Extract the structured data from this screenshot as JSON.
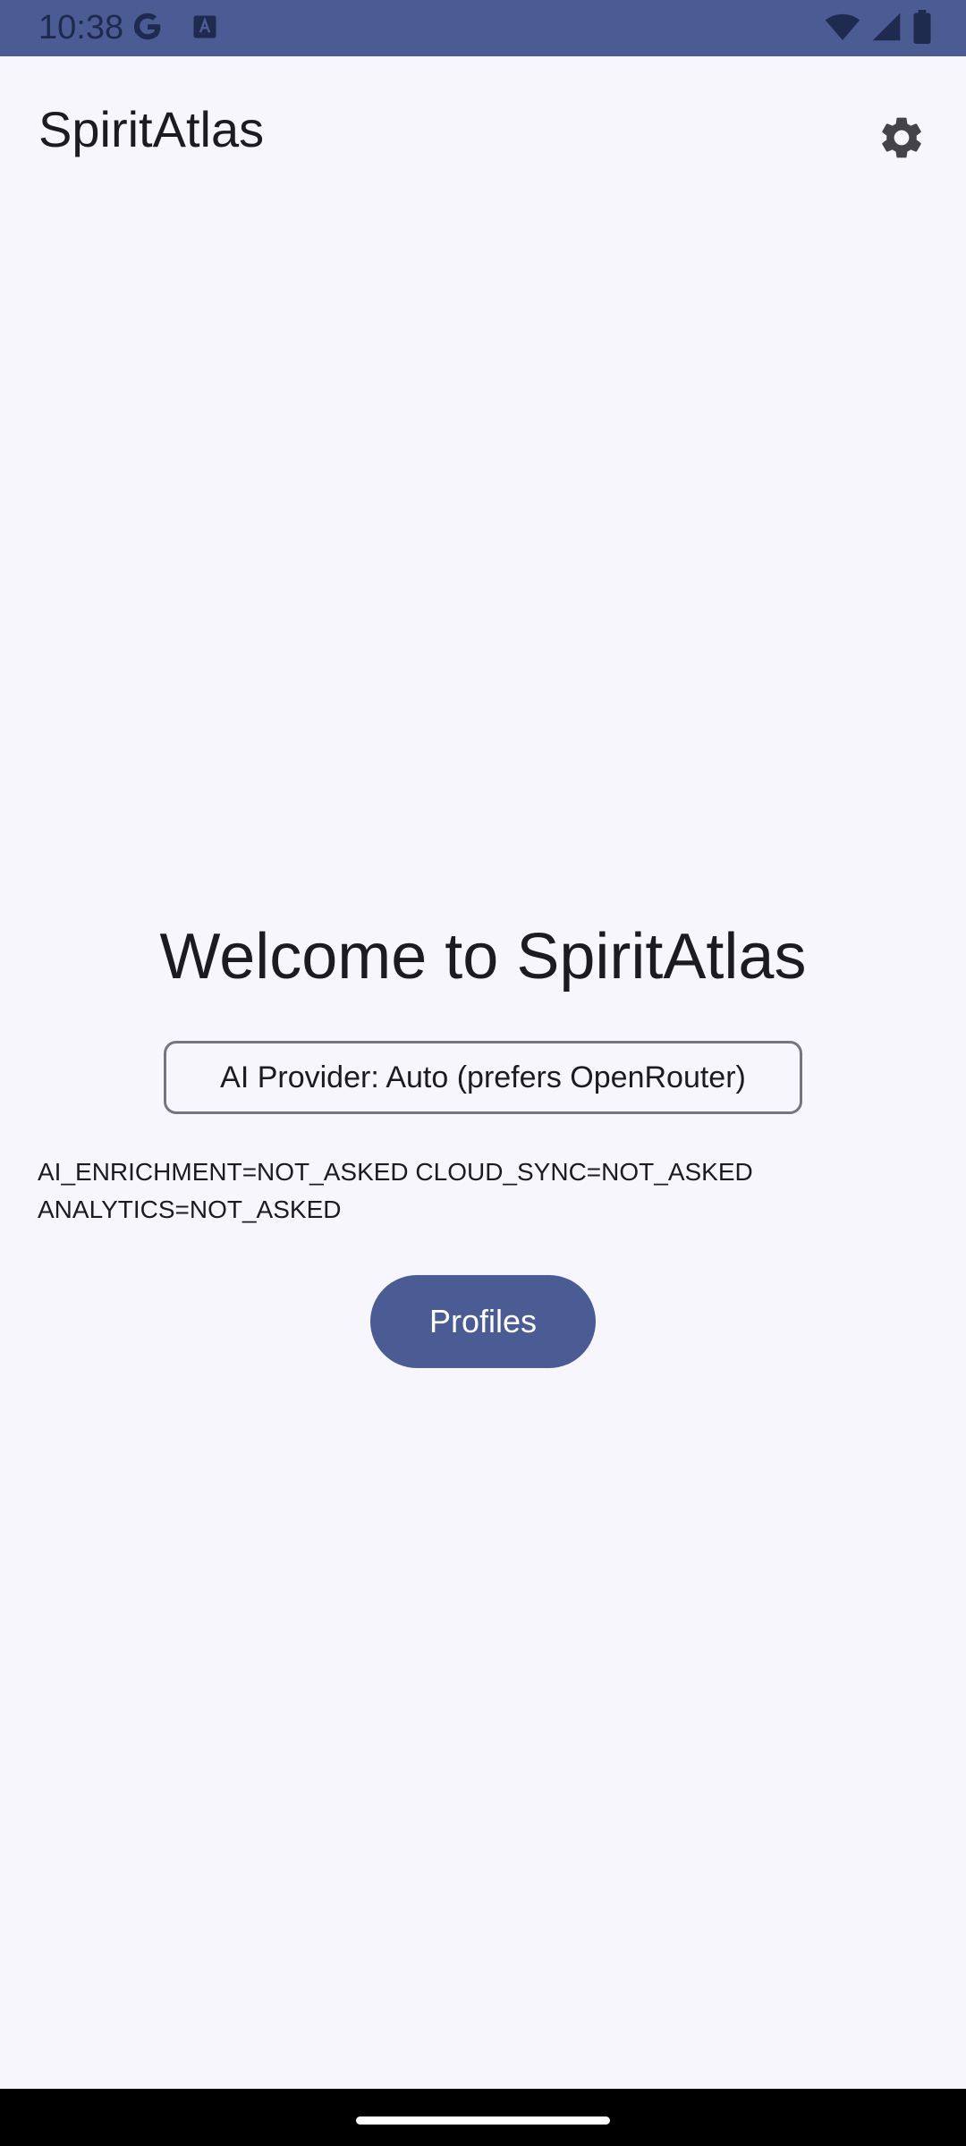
{
  "status_bar": {
    "time": "10:38",
    "left_icons": [
      "google-icon",
      "text-icon"
    ],
    "right_icons": [
      "wifi-icon",
      "signal-icon",
      "battery-icon"
    ],
    "color": "#4b5b94"
  },
  "app_bar": {
    "title": "SpiritAtlas",
    "settings_icon": "gear-icon"
  },
  "main": {
    "welcome": "Welcome to SpiritAtlas",
    "provider_button": "AI Provider: Auto (prefers OpenRouter)",
    "consent_status": "AI_ENRICHMENT=NOT_ASKED  CLOUD_SYNC=NOT_ASKED  ANALYTICS=NOT_ASKED",
    "profiles_button": "Profiles"
  },
  "colors": {
    "accent": "#4b5b94",
    "background": "#f7f6fc",
    "text": "#1c1b20",
    "outline": "#76747c"
  }
}
